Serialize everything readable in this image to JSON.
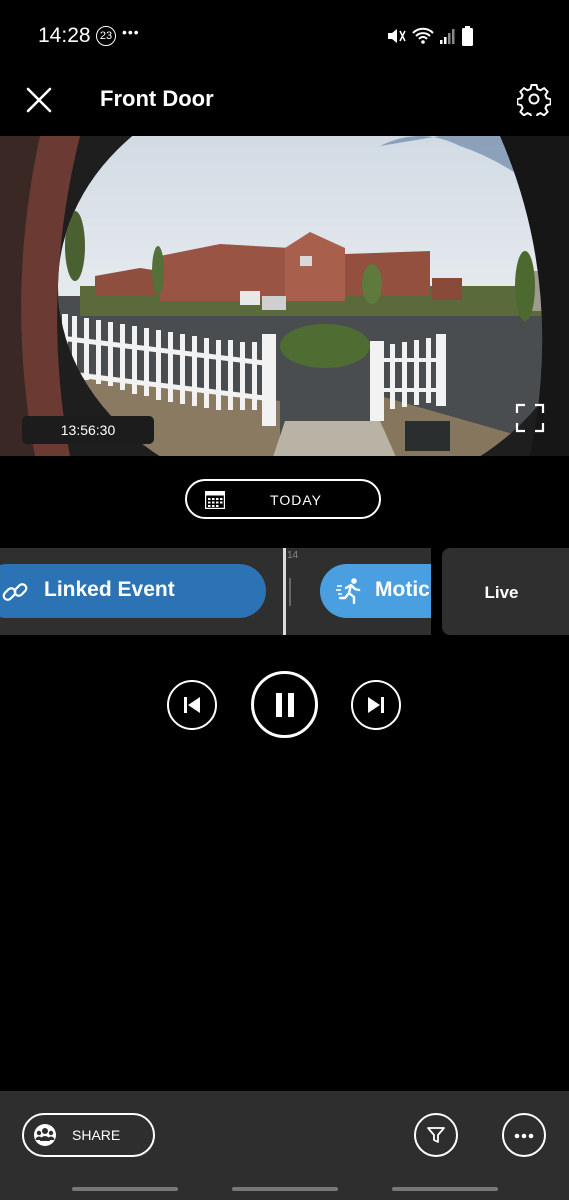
{
  "status_bar": {
    "time": "14:28",
    "badge": "23",
    "dots": "•••"
  },
  "header": {
    "title": "Front Door",
    "close_icon": "close-icon",
    "settings_icon": "gear-icon"
  },
  "video": {
    "timestamp": "13:56:30",
    "fullscreen_icon": "fullscreen-icon"
  },
  "date_picker": {
    "label": "TODAY",
    "icon": "calendar-icon"
  },
  "timeline": {
    "events": [
      {
        "label": "Linked Event",
        "icon": "link-icon",
        "color": "#2b73b5"
      },
      {
        "label": "Motic",
        "icon": "running-person-icon",
        "color": "#4a9fe0"
      }
    ],
    "playhead_label": "14",
    "live_label": "Live"
  },
  "playback": {
    "prev_icon": "skip-previous-icon",
    "pause_icon": "pause-icon",
    "next_icon": "skip-next-icon"
  },
  "bottom_bar": {
    "share_label": "SHARE",
    "share_icon": "share-avatars-icon",
    "filter_icon": "filter-icon",
    "more_icon": "more-icon"
  }
}
